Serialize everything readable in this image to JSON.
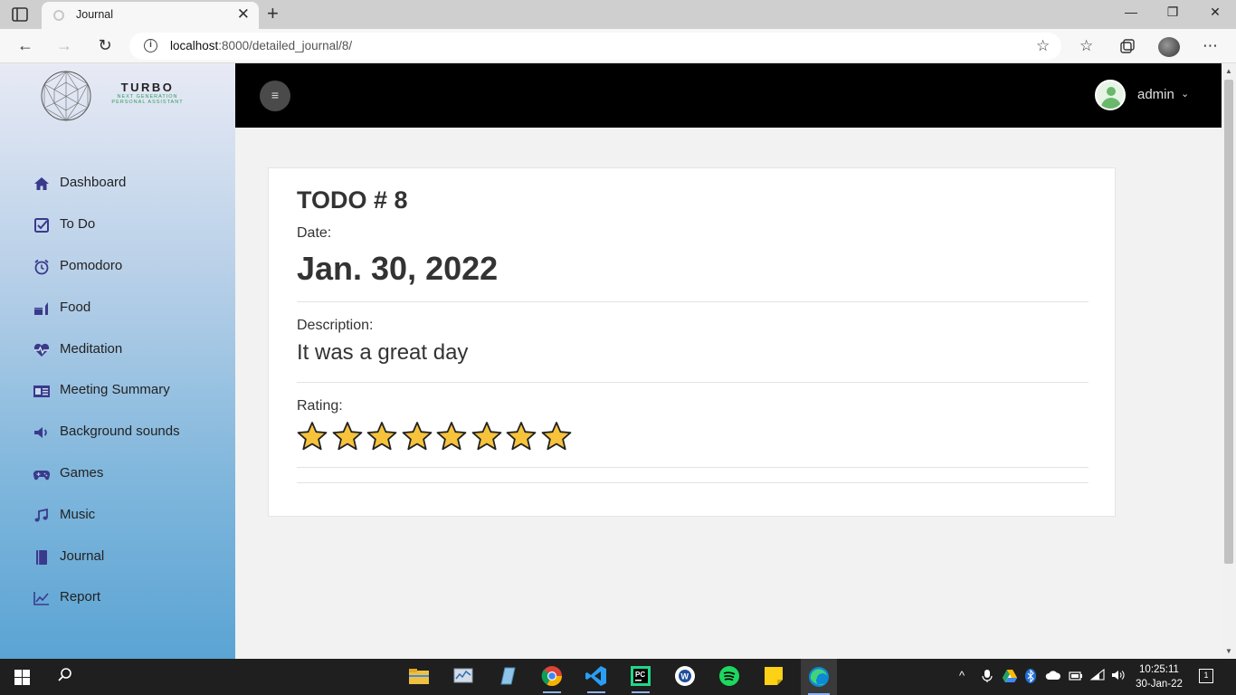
{
  "browser": {
    "tab_title": "Journal",
    "tab_close": "✕",
    "new_tab": "+",
    "url_host": "localhost",
    "url_path": ":8000/detailed_journal/8/"
  },
  "sidebar": {
    "brand_title": "TURBO",
    "brand_subtitle_1": "NEXT GENERATION",
    "brand_subtitle_2": "PERSONAL ASSISTANT",
    "items": [
      {
        "label": "Dashboard",
        "icon": "home-icon"
      },
      {
        "label": "To Do",
        "icon": "checkbox-icon"
      },
      {
        "label": "Pomodoro",
        "icon": "alarm-clock-icon"
      },
      {
        "label": "Food",
        "icon": "food-icon"
      },
      {
        "label": "Meditation",
        "icon": "heartbeat-icon"
      },
      {
        "label": "Meeting Summary",
        "icon": "summary-icon"
      },
      {
        "label": "Background sounds",
        "icon": "volume-icon"
      },
      {
        "label": "Games",
        "icon": "gamepad-icon"
      },
      {
        "label": "Music",
        "icon": "music-note-icon"
      },
      {
        "label": "Journal",
        "icon": "book-icon"
      },
      {
        "label": "Report",
        "icon": "line-chart-icon"
      }
    ]
  },
  "header": {
    "user_name": "admin"
  },
  "journal": {
    "title": "TODO # 8",
    "date_label": "Date:",
    "date_value": "Jan. 30, 2022",
    "description_label": "Description:",
    "description_value": "It was a great day",
    "rating_label": "Rating:",
    "rating_stars": 8
  },
  "colors": {
    "sidebar_accent": "#3a3a8c",
    "star_fill": "#f7c33b",
    "header_bg": "#000000"
  },
  "taskbar": {
    "time": "10:25:11",
    "date": "30-Jan-22",
    "notifications": "1"
  }
}
